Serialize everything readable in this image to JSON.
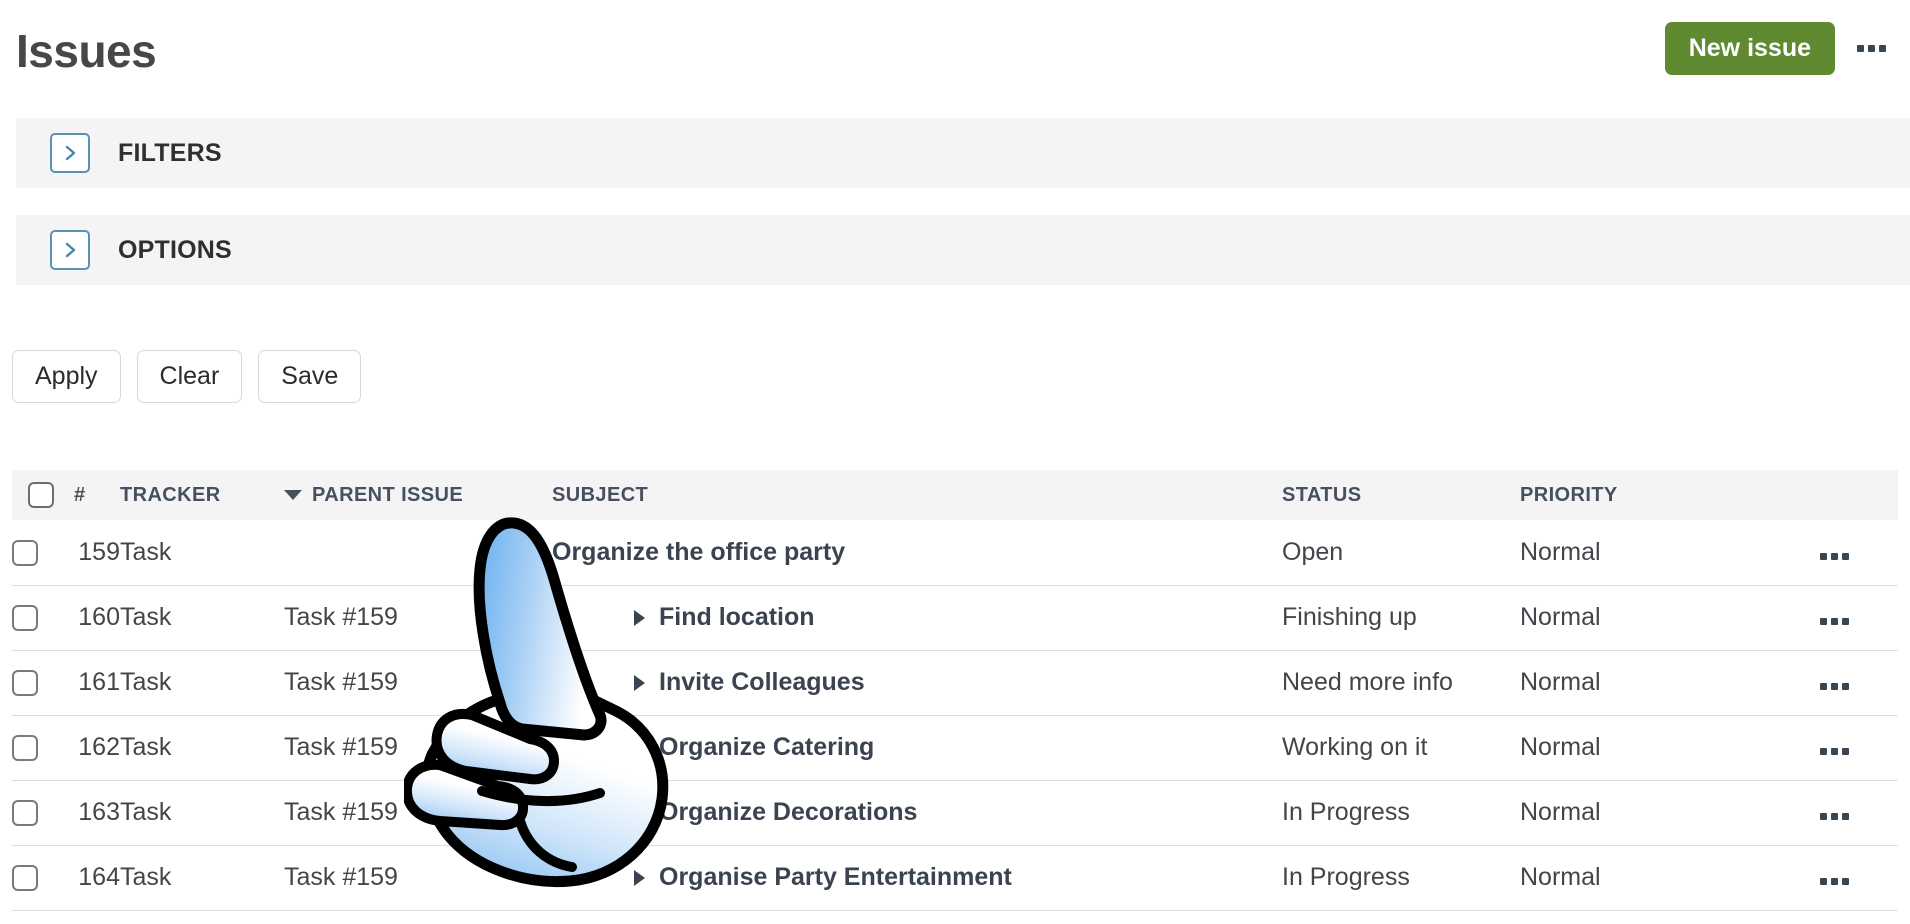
{
  "header": {
    "title": "Issues",
    "new_issue_label": "New issue",
    "more_menu_icon": "kebab-menu-icon"
  },
  "panels": [
    {
      "label": "FILTERS",
      "toggle_icon": "chevron-right-icon",
      "expanded": false
    },
    {
      "label": "OPTIONS",
      "toggle_icon": "chevron-right-icon",
      "expanded": false
    }
  ],
  "actions": {
    "apply_label": "Apply",
    "clear_label": "Clear",
    "save_label": "Save"
  },
  "table": {
    "columns": {
      "id": "#",
      "tracker": "TRACKER",
      "parent_issue": "PARENT ISSUE",
      "subject": "SUBJECT",
      "status": "STATUS",
      "priority": "PRIORITY"
    },
    "sorted_column": "PARENT ISSUE",
    "sort_direction": "descending",
    "rows": [
      {
        "id": "159",
        "tracker": "Task",
        "parent": "",
        "subject": "Organize the office party",
        "status": "Open",
        "priority": "Normal",
        "child": false
      },
      {
        "id": "160",
        "tracker": "Task",
        "parent": "Task #159",
        "subject": "Find location",
        "status": "Finishing up",
        "priority": "Normal",
        "child": true
      },
      {
        "id": "161",
        "tracker": "Task",
        "parent": "Task #159",
        "subject": "Invite Colleagues",
        "status": "Need more info",
        "priority": "Normal",
        "child": true
      },
      {
        "id": "162",
        "tracker": "Task",
        "parent": "Task #159",
        "subject": "Organize Catering",
        "status": "Working on it",
        "priority": "Normal",
        "child": true
      },
      {
        "id": "163",
        "tracker": "Task",
        "parent": "Task #159",
        "subject": "Organize Decorations",
        "status": "In Progress",
        "priority": "Normal",
        "child": true
      },
      {
        "id": "164",
        "tracker": "Task",
        "parent": "Task #159",
        "subject": "Organise Party Entertainment",
        "status": "In Progress",
        "priority": "Normal",
        "child": true
      }
    ]
  },
  "overlay": {
    "cursor_icon": "pointing-hand-cursor"
  },
  "colors": {
    "accent_green": "#5f8a2f",
    "panel_bg": "#f4f4f4",
    "toggle_border": "#5b91b4",
    "text_dark": "#3b4350",
    "row_border": "#dedede"
  }
}
